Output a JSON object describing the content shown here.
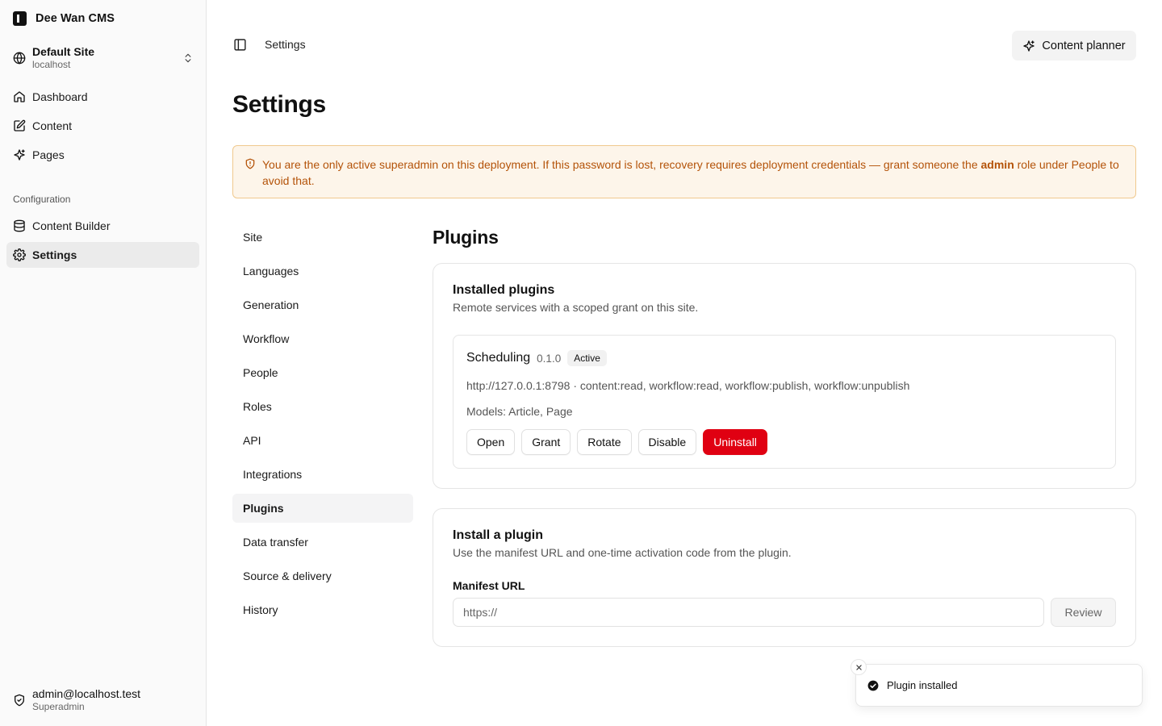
{
  "app": {
    "name": "Dee Wan CMS"
  },
  "site": {
    "name": "Default Site",
    "host": "localhost"
  },
  "sidebar": {
    "main_items": [
      {
        "label": "Dashboard",
        "icon": "home-icon"
      },
      {
        "label": "Content",
        "icon": "edit-icon"
      },
      {
        "label": "Pages",
        "icon": "sparkles-icon"
      }
    ],
    "section_label": "Configuration",
    "config_items": [
      {
        "label": "Content Builder",
        "icon": "database-icon"
      },
      {
        "label": "Settings",
        "icon": "gear-icon",
        "active": true
      }
    ]
  },
  "user": {
    "email": "admin@localhost.test",
    "role": "Superadmin"
  },
  "header": {
    "breadcrumb": "Settings",
    "planner_label": "Content planner"
  },
  "page": {
    "title": "Settings"
  },
  "alert": {
    "text_before": "You are the only active superadmin on this deployment. If this password is lost, recovery requires deployment credentials — grant someone the ",
    "text_bold": "admin",
    "text_after": " role under People to avoid that.",
    "color": "#b45309"
  },
  "subnav": {
    "items": [
      "Site",
      "Languages",
      "Generation",
      "Workflow",
      "People",
      "Roles",
      "API",
      "Integrations",
      "Plugins",
      "Data transfer",
      "Source & delivery",
      "History"
    ],
    "active": "Plugins"
  },
  "plugins_section": {
    "title": "Plugins",
    "installed": {
      "title": "Installed plugins",
      "description": "Remote services with a scoped grant on this site.",
      "plugin": {
        "name": "Scheduling",
        "version": "0.1.0",
        "status": "Active",
        "endpoint_line": "http://127.0.0.1:8798 · content:read, workflow:read, workflow:publish, workflow:unpublish",
        "models_line": "Models: Article, Page",
        "actions": {
          "open": "Open",
          "grant": "Grant",
          "rotate": "Rotate",
          "disable": "Disable",
          "uninstall": "Uninstall"
        }
      }
    },
    "install": {
      "title": "Install a plugin",
      "description": "Use the manifest URL and one-time activation code from the plugin.",
      "field_label": "Manifest URL",
      "placeholder": "https://",
      "review_label": "Review"
    }
  },
  "toast": {
    "message": "Plugin installed"
  },
  "colors": {
    "danger": "#e00012",
    "alert_bg": "#fdf5ea",
    "alert_border": "#f0c98e"
  }
}
